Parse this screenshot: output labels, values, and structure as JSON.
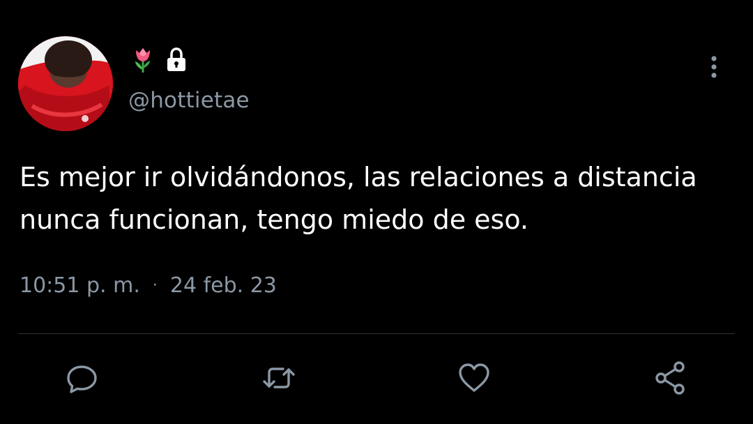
{
  "tweet": {
    "display_name_icons": [
      "tulip-icon",
      "lock-icon"
    ],
    "handle": "@hottietae",
    "text": "Es mejor ir olvidándonos, las relaciones a distancia nunca funcionan, tengo miedo de eso.",
    "time": "10:51 p. m.",
    "separator": "·",
    "date": "24 feb. 23"
  },
  "actions": [
    "reply-icon",
    "retweet-icon",
    "like-icon",
    "share-icon"
  ],
  "colors": {
    "background": "#000000",
    "text": "#ffffff",
    "secondary": "#8b98a5",
    "divider": "#2f3336"
  }
}
